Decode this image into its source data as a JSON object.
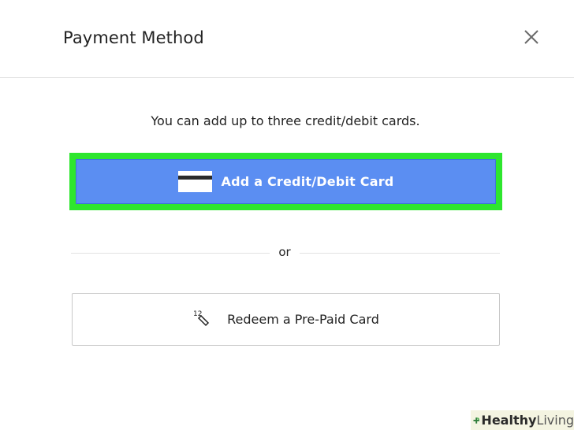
{
  "dialog": {
    "title": "Payment Method",
    "close_icon": "close-icon",
    "message": "You can add up to three credit/debit cards.",
    "add_card_button": {
      "label": "Add a Credit/Debit Card",
      "icon": "credit-card-icon",
      "highlight_color": "#2ee62e",
      "color": "#5b8ef2"
    },
    "separator_text": "or",
    "redeem_button": {
      "label": "Redeem a Pre-Paid Card",
      "icon": "ticket-icon",
      "icon_numbers": "12"
    }
  },
  "watermark": {
    "brand_bold": "Healthy",
    "brand_light": "Living",
    "icon": "plus-leaf-icon"
  }
}
